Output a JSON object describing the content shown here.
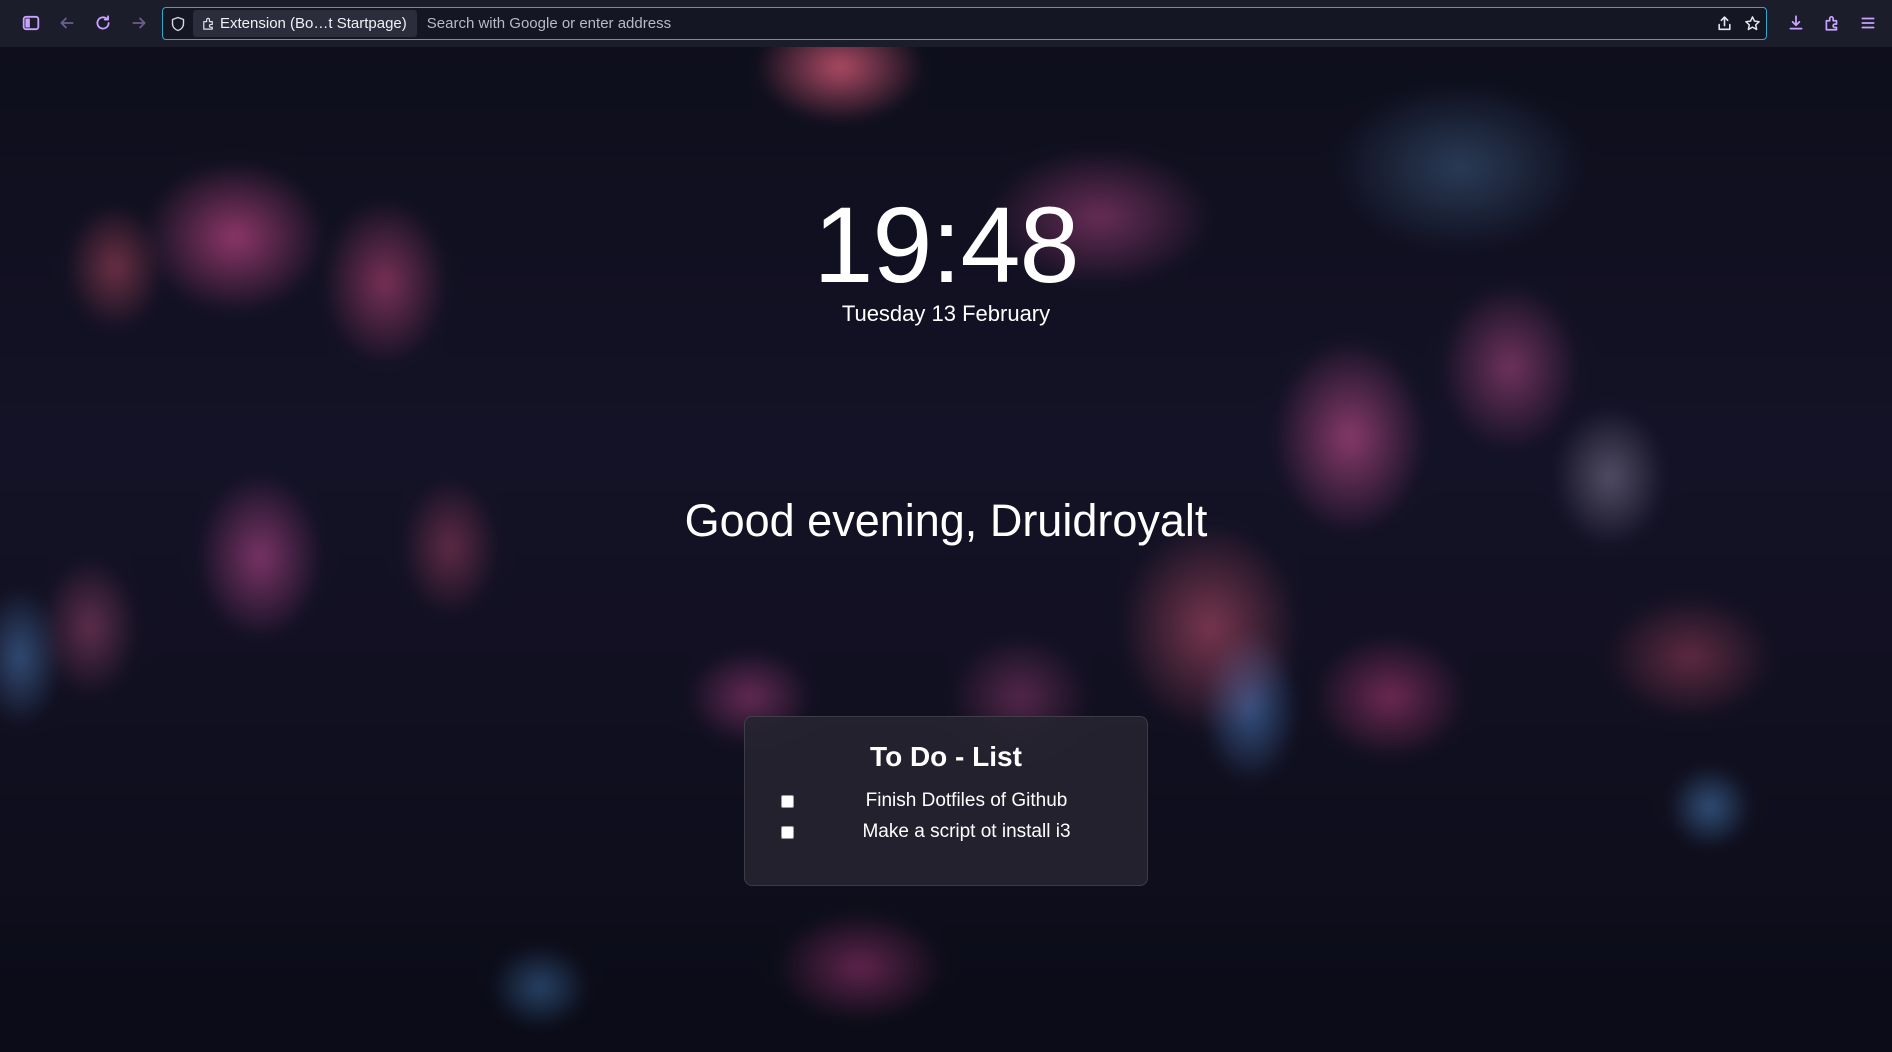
{
  "browser": {
    "identity_label": "Extension (Bo…t Startpage)",
    "url_placeholder": "Search with Google or enter address"
  },
  "icons": {
    "toolbar_left": [
      "sidebar-icon",
      "back-icon",
      "reload-icon",
      "forward-icon"
    ],
    "urlbar": [
      "shield-icon",
      "extension-icon",
      "share-icon",
      "bookmark-star-icon"
    ],
    "toolbar_right": [
      "download-icon",
      "extensions-icon",
      "menu-icon"
    ]
  },
  "colors": {
    "accent": "#c9a3ff",
    "urlbar_focus_border": "#35a8c9",
    "toolbar_bg": "#1b1d2b"
  },
  "startpage": {
    "time": "19:48",
    "date": "Tuesday 13 February",
    "greeting": "Good evening, Druidroyalt"
  },
  "todo": {
    "title": "To Do - List",
    "items": [
      {
        "label": "Finish Dotfiles of Github",
        "checked": false
      },
      {
        "label": "Make a script ot install i3",
        "checked": false
      }
    ]
  }
}
